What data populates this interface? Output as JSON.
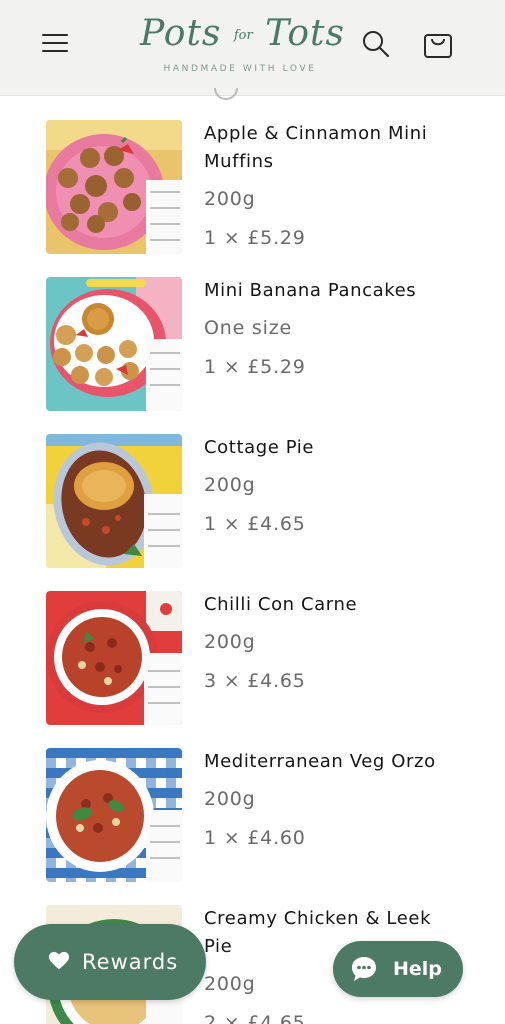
{
  "header": {
    "logo_main_left": "Pots",
    "logo_main_for": "for",
    "logo_main_right": "Tots",
    "logo_tagline": "HANDMADE WITH LOVE",
    "menu_icon": "hamburger-menu-icon",
    "search_icon": "search-icon",
    "cart_icon": "shopping-bag-icon"
  },
  "cart_items": [
    {
      "title": "Apple & Cinnamon Mini Muffins",
      "size": "200g",
      "price": "1 × £5.29"
    },
    {
      "title": "Mini Banana Pancakes",
      "size": "One size",
      "price": "1 × £5.29"
    },
    {
      "title": "Cottage Pie",
      "size": "200g",
      "price": "1 × £4.65"
    },
    {
      "title": "Chilli Con Carne",
      "size": "200g",
      "price": "3 × £4.65"
    },
    {
      "title": "Mediterranean Veg Orzo",
      "size": "200g",
      "price": "1 × £4.60"
    },
    {
      "title": "Creamy Chicken & Leek Pie",
      "size": "200g",
      "price": "2 × £4.65"
    }
  ],
  "rewards": {
    "label": "Rewards",
    "icon": "heart-icon"
  },
  "help": {
    "label": "Help",
    "icon": "chat-bubble-icon"
  },
  "colors": {
    "brand_green": "#4d7a64",
    "header_bg": "#f2f2f0"
  }
}
